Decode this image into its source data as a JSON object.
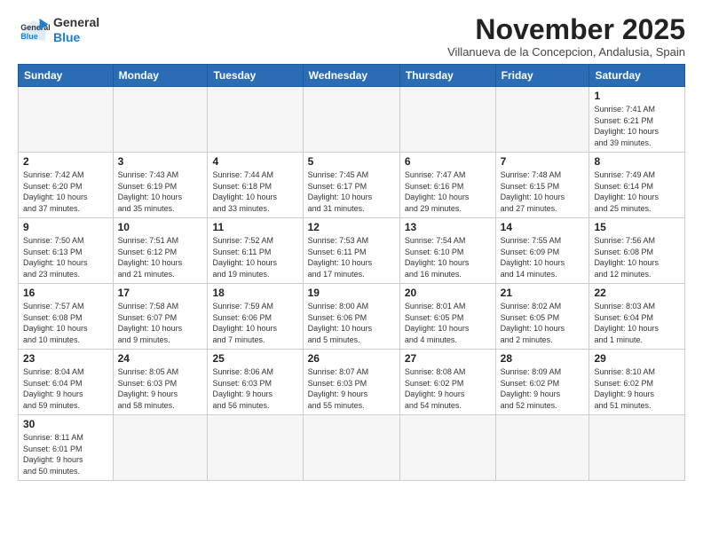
{
  "logo": {
    "line1": "General",
    "line2": "Blue"
  },
  "title": "November 2025",
  "subtitle": "Villanueva de la Concepcion, Andalusia, Spain",
  "days_of_week": [
    "Sunday",
    "Monday",
    "Tuesday",
    "Wednesday",
    "Thursday",
    "Friday",
    "Saturday"
  ],
  "weeks": [
    [
      {
        "day": "",
        "info": ""
      },
      {
        "day": "",
        "info": ""
      },
      {
        "day": "",
        "info": ""
      },
      {
        "day": "",
        "info": ""
      },
      {
        "day": "",
        "info": ""
      },
      {
        "day": "",
        "info": ""
      },
      {
        "day": "1",
        "info": "Sunrise: 7:41 AM\nSunset: 6:21 PM\nDaylight: 10 hours\nand 39 minutes."
      }
    ],
    [
      {
        "day": "2",
        "info": "Sunrise: 7:42 AM\nSunset: 6:20 PM\nDaylight: 10 hours\nand 37 minutes."
      },
      {
        "day": "3",
        "info": "Sunrise: 7:43 AM\nSunset: 6:19 PM\nDaylight: 10 hours\nand 35 minutes."
      },
      {
        "day": "4",
        "info": "Sunrise: 7:44 AM\nSunset: 6:18 PM\nDaylight: 10 hours\nand 33 minutes."
      },
      {
        "day": "5",
        "info": "Sunrise: 7:45 AM\nSunset: 6:17 PM\nDaylight: 10 hours\nand 31 minutes."
      },
      {
        "day": "6",
        "info": "Sunrise: 7:47 AM\nSunset: 6:16 PM\nDaylight: 10 hours\nand 29 minutes."
      },
      {
        "day": "7",
        "info": "Sunrise: 7:48 AM\nSunset: 6:15 PM\nDaylight: 10 hours\nand 27 minutes."
      },
      {
        "day": "8",
        "info": "Sunrise: 7:49 AM\nSunset: 6:14 PM\nDaylight: 10 hours\nand 25 minutes."
      }
    ],
    [
      {
        "day": "9",
        "info": "Sunrise: 7:50 AM\nSunset: 6:13 PM\nDaylight: 10 hours\nand 23 minutes."
      },
      {
        "day": "10",
        "info": "Sunrise: 7:51 AM\nSunset: 6:12 PM\nDaylight: 10 hours\nand 21 minutes."
      },
      {
        "day": "11",
        "info": "Sunrise: 7:52 AM\nSunset: 6:11 PM\nDaylight: 10 hours\nand 19 minutes."
      },
      {
        "day": "12",
        "info": "Sunrise: 7:53 AM\nSunset: 6:11 PM\nDaylight: 10 hours\nand 17 minutes."
      },
      {
        "day": "13",
        "info": "Sunrise: 7:54 AM\nSunset: 6:10 PM\nDaylight: 10 hours\nand 16 minutes."
      },
      {
        "day": "14",
        "info": "Sunrise: 7:55 AM\nSunset: 6:09 PM\nDaylight: 10 hours\nand 14 minutes."
      },
      {
        "day": "15",
        "info": "Sunrise: 7:56 AM\nSunset: 6:08 PM\nDaylight: 10 hours\nand 12 minutes."
      }
    ],
    [
      {
        "day": "16",
        "info": "Sunrise: 7:57 AM\nSunset: 6:08 PM\nDaylight: 10 hours\nand 10 minutes."
      },
      {
        "day": "17",
        "info": "Sunrise: 7:58 AM\nSunset: 6:07 PM\nDaylight: 10 hours\nand 9 minutes."
      },
      {
        "day": "18",
        "info": "Sunrise: 7:59 AM\nSunset: 6:06 PM\nDaylight: 10 hours\nand 7 minutes."
      },
      {
        "day": "19",
        "info": "Sunrise: 8:00 AM\nSunset: 6:06 PM\nDaylight: 10 hours\nand 5 minutes."
      },
      {
        "day": "20",
        "info": "Sunrise: 8:01 AM\nSunset: 6:05 PM\nDaylight: 10 hours\nand 4 minutes."
      },
      {
        "day": "21",
        "info": "Sunrise: 8:02 AM\nSunset: 6:05 PM\nDaylight: 10 hours\nand 2 minutes."
      },
      {
        "day": "22",
        "info": "Sunrise: 8:03 AM\nSunset: 6:04 PM\nDaylight: 10 hours\nand 1 minute."
      }
    ],
    [
      {
        "day": "23",
        "info": "Sunrise: 8:04 AM\nSunset: 6:04 PM\nDaylight: 9 hours\nand 59 minutes."
      },
      {
        "day": "24",
        "info": "Sunrise: 8:05 AM\nSunset: 6:03 PM\nDaylight: 9 hours\nand 58 minutes."
      },
      {
        "day": "25",
        "info": "Sunrise: 8:06 AM\nSunset: 6:03 PM\nDaylight: 9 hours\nand 56 minutes."
      },
      {
        "day": "26",
        "info": "Sunrise: 8:07 AM\nSunset: 6:03 PM\nDaylight: 9 hours\nand 55 minutes."
      },
      {
        "day": "27",
        "info": "Sunrise: 8:08 AM\nSunset: 6:02 PM\nDaylight: 9 hours\nand 54 minutes."
      },
      {
        "day": "28",
        "info": "Sunrise: 8:09 AM\nSunset: 6:02 PM\nDaylight: 9 hours\nand 52 minutes."
      },
      {
        "day": "29",
        "info": "Sunrise: 8:10 AM\nSunset: 6:02 PM\nDaylight: 9 hours\nand 51 minutes."
      }
    ],
    [
      {
        "day": "30",
        "info": "Sunrise: 8:11 AM\nSunset: 6:01 PM\nDaylight: 9 hours\nand 50 minutes."
      },
      {
        "day": "",
        "info": ""
      },
      {
        "day": "",
        "info": ""
      },
      {
        "day": "",
        "info": ""
      },
      {
        "day": "",
        "info": ""
      },
      {
        "day": "",
        "info": ""
      },
      {
        "day": "",
        "info": ""
      }
    ]
  ]
}
